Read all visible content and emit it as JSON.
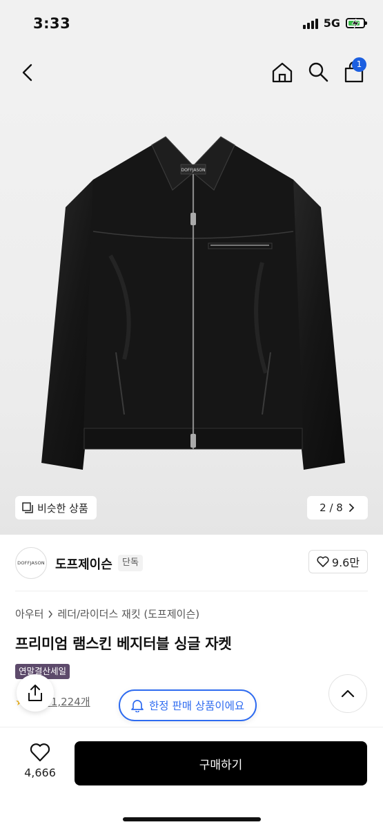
{
  "status_bar": {
    "time": "3:33",
    "network": "5G"
  },
  "nav": {
    "cart_badge": "1"
  },
  "gallery": {
    "similar_label": "비슷한 상품",
    "pager": "2 / 8",
    "jacket_label": "DOFFJASON"
  },
  "brand": {
    "logo_text": "DOFFJASON",
    "name": "도프제이슨",
    "tag": "단독",
    "likes": "9.6만"
  },
  "product": {
    "breadcrumb": [
      "아우터",
      "레더/라이더스 재킷 (도프제이슨)"
    ],
    "title": "프리미엄 램스킨 베지터블 싱글 자켓",
    "sale_tag": "연말결산세일",
    "review_label": "후기 1,224개"
  },
  "floating": {
    "limited_label": "한정 판매 상품이에요"
  },
  "bottom": {
    "wish_count": "4,666",
    "buy_label": "구매하기"
  },
  "colors": {
    "accent": "#2e6bf0",
    "badge": "#1c5fe0",
    "sale_tag": "#5d4a6b",
    "buy": "#000000"
  }
}
